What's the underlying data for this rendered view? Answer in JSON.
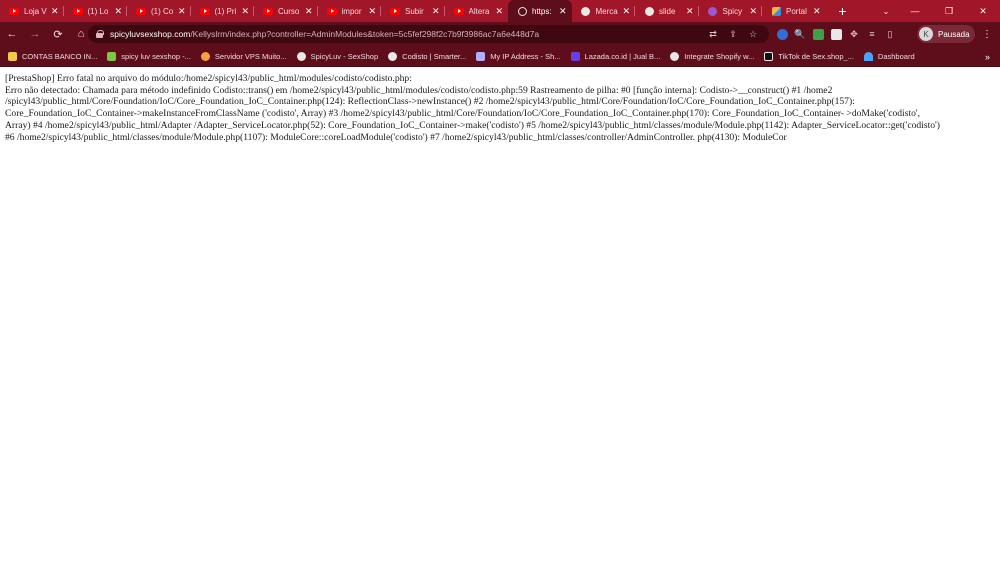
{
  "tabs": [
    {
      "title": "Loja V",
      "icon": "youtube-icon",
      "active": false
    },
    {
      "title": "(1) Lo",
      "icon": "youtube-icon",
      "active": false
    },
    {
      "title": "(1) Co",
      "icon": "youtube-icon",
      "active": false
    },
    {
      "title": "(1) Pri",
      "icon": "youtube-icon",
      "active": false
    },
    {
      "title": "Curso",
      "icon": "youtube-icon",
      "active": false
    },
    {
      "title": "impor",
      "icon": "youtube-icon",
      "active": false
    },
    {
      "title": "Subir",
      "icon": "youtube-icon",
      "active": false
    },
    {
      "title": "Altera",
      "icon": "youtube-icon",
      "active": false
    },
    {
      "title": "https:",
      "icon": "globe-icon",
      "active": true
    },
    {
      "title": "Merca",
      "icon": "site-icon",
      "active": false
    },
    {
      "title": "slide",
      "icon": "site-icon",
      "active": false
    },
    {
      "title": "Spicy",
      "icon": "spicy-icon",
      "active": false
    },
    {
      "title": "Portal",
      "icon": "portal-icon",
      "active": false
    }
  ],
  "tab_close_glyph": "✕",
  "new_tab_glyph": "+",
  "window_controls": {
    "minimize": "—",
    "restore": "❐",
    "close": "✕"
  },
  "toolbar": {
    "back": "←",
    "forward": "→",
    "reload": "⟳",
    "home": "⌂",
    "url_host": "spicyluvsexshop.com",
    "url_path": "/Kellyslrm/index.php?controller=AdminModules&token=5c5fef298f2c7b9f3986ac7a6e448d7a",
    "profile_initial": "K",
    "profile_label": "Pausada",
    "menu": "⋮"
  },
  "bookmarks": [
    {
      "label": "CONTAS BANCO IN...",
      "color": "#f2c94c"
    },
    {
      "label": "spicy luv sexshop -...",
      "color": "#7ac943"
    },
    {
      "label": "Servidor VPS Muito...",
      "color": "#f6a23c"
    },
    {
      "label": "SpicyLuv - SexShop",
      "color": "#e8e8e8"
    },
    {
      "label": "Codisto | Smarter...",
      "color": "#e8e8e8"
    },
    {
      "label": "My IP Address - Sh...",
      "color": "#b0b0ff"
    },
    {
      "label": "Lazada.co.id | Jual B...",
      "color": "#6a3de8"
    },
    {
      "label": "Integrate Shopify w...",
      "color": "#e8e8e8"
    },
    {
      "label": "TikTok de Sex.shop_...",
      "color": "#111111"
    },
    {
      "label": "Dashboard",
      "color": "#4aa3ff"
    }
  ],
  "bookmarks_more": "»",
  "error_lines": [
    "[PrestaShop] Erro fatal no arquivo do módulo:/home2/spicyl43/public_html/modules/codisto/codisto.php:",
    "Erro não detectado: Chamada para método indefinido Codisto::trans() em /home2/spicyl43/public_html/modules/codisto/codisto.php:59 Rastreamento de pilha: #0 [função interna]: Codisto->__construct() #1 /home2 /spicyl43/public_html/Core/Foundation/IoC/Core_Foundation_IoC_Container.php(124): ReflectionClass->newInstance() #2 /home2/spicyl43/public_html/Core/Foundation/IoC/Core_Foundation_IoC_Container.php(157): Core_Foundation_IoC_Container->makeInstanceFromClassName ('codisto', Array) #3 /home2/spicyl43/public_html/Core/Foundation/IoC/Core_Foundation_IoC_Container.php(170): Core_Foundation_IoC_Container- >doMake('codisto', Array) #4 /home2/spicyl43/public_html/Adapter /Adapter_ServiceLocator.php(52): Core_Foundation_IoC_Container->make('codisto') #5 /home2/spicyl43/public_html/classes/module/Module.php(1142): Adapter_ServiceLocator::get('codisto') #6 /home2/spicyl43/public_html/classes/module/Module.php(1107): ModuleCore::coreLoadModule('codisto') #7 /home2/spicyl43/public_html/classes/controller/AdminController. php(4130): ModuleCor"
  ]
}
